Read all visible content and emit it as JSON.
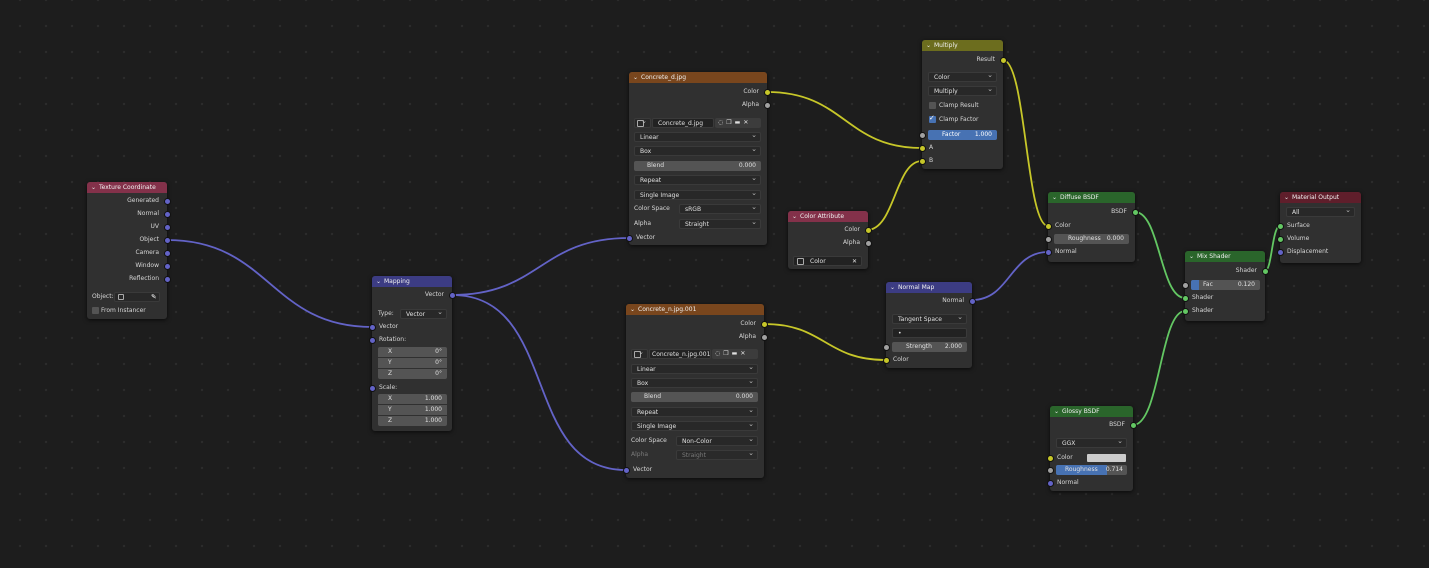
{
  "colors": {
    "background": "#1d1d1d",
    "input_header": "#83314a",
    "texture_header": "#79461d",
    "vector_header": "#3c3c83",
    "color_header": "#6c6d1e",
    "shader_header": "#2a652b",
    "output_header": "#5f1e2b",
    "wire_color": "#c7c729",
    "wire_vector": "#6363c7",
    "wire_shader": "#63c763",
    "field_highlight": "#4772b3"
  },
  "texture_coordinate": {
    "title": "Texture Coordinate",
    "outputs": [
      "Generated",
      "Normal",
      "UV",
      "Object",
      "Camera",
      "Window",
      "Reflection"
    ],
    "object_label": "Object:",
    "from_instancer": "From Instancer"
  },
  "mapping": {
    "title": "Mapping",
    "output": "Vector",
    "type_label": "Type:",
    "type_value": "Vector",
    "vector_label": "Vector",
    "rotation_label": "Rotation:",
    "rotation": [
      {
        "axis": "X",
        "value": "0°"
      },
      {
        "axis": "Y",
        "value": "0°"
      },
      {
        "axis": "Z",
        "value": "0°"
      }
    ],
    "scale_label": "Scale:",
    "scale": [
      {
        "axis": "X",
        "value": "1.000"
      },
      {
        "axis": "Y",
        "value": "1.000"
      },
      {
        "axis": "Z",
        "value": "1.000"
      }
    ]
  },
  "tex_d": {
    "title": "Concrete_d.jpg",
    "out_color": "Color",
    "out_alpha": "Alpha",
    "image_name": "Concrete_d.jpg",
    "interpolation": "Linear",
    "projection": "Box",
    "blend_label": "Blend",
    "blend_value": "0.000",
    "extension": "Repeat",
    "source": "Single Image",
    "color_space_label": "Color Space",
    "color_space": "sRGB",
    "alpha_label": "Alpha",
    "alpha_mode": "Straight",
    "in_vector": "Vector"
  },
  "tex_n": {
    "title": "Concrete_n.jpg.001",
    "out_color": "Color",
    "out_alpha": "Alpha",
    "image_name": "Concrete_n.jpg.001",
    "interpolation": "Linear",
    "projection": "Box",
    "blend_label": "Blend",
    "blend_value": "0.000",
    "extension": "Repeat",
    "source": "Single Image",
    "color_space_label": "Color Space",
    "color_space": "Non-Color",
    "alpha_label": "Alpha",
    "alpha_mode": "Straight",
    "in_vector": "Vector"
  },
  "color_attribute": {
    "title": "Color Attribute",
    "out_color": "Color",
    "out_alpha": "Alpha",
    "layer": "Color"
  },
  "multiply": {
    "title": "Multiply",
    "out_result": "Result",
    "data_type": "Color",
    "blend_type": "Multiply",
    "clamp_result": "Clamp Result",
    "clamp_factor": "Clamp Factor",
    "factor_label": "Factor",
    "factor_value": "1.000",
    "in_a": "A",
    "in_b": "B"
  },
  "normal_map": {
    "title": "Normal Map",
    "out_normal": "Normal",
    "space": "Tangent Space",
    "uv_value": "•",
    "strength_label": "Strength",
    "strength_value": "2.000",
    "in_color": "Color"
  },
  "diffuse": {
    "title": "Diffuse BSDF",
    "out_bsdf": "BSDF",
    "in_color": "Color",
    "roughness_label": "Roughness",
    "roughness_value": "0.000",
    "in_normal": "Normal"
  },
  "glossy": {
    "title": "Glossy BSDF",
    "out_bsdf": "BSDF",
    "distribution": "GGX",
    "in_color": "Color",
    "roughness_label": "Roughness",
    "roughness_value": "0.714",
    "in_normal": "Normal"
  },
  "mix_shader": {
    "title": "Mix Shader",
    "out_shader": "Shader",
    "fac_label": "Fac",
    "fac_value": "0.120",
    "in_shader1": "Shader",
    "in_shader2": "Shader"
  },
  "material_output": {
    "title": "Material Output",
    "target": "All",
    "in_surface": "Surface",
    "in_volume": "Volume",
    "in_displacement": "Displacement"
  }
}
